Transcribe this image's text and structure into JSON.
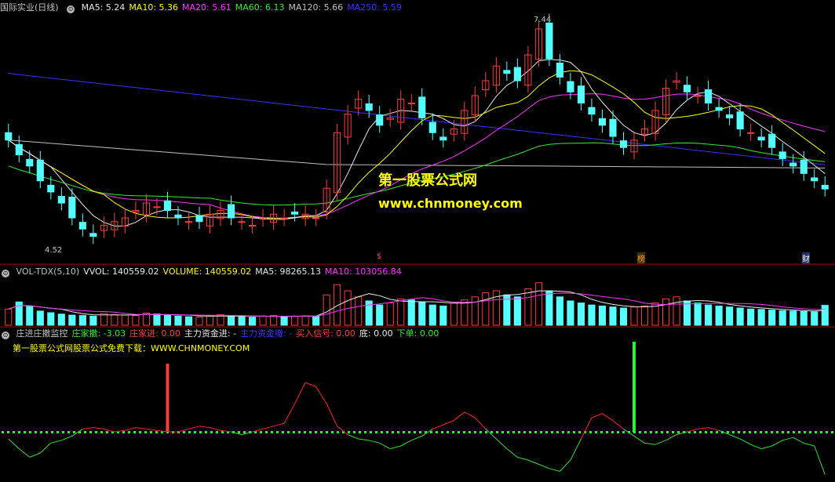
{
  "colors": {
    "bg": "#000000",
    "divider": "#9b0000",
    "up": "#ff3b3b",
    "down": "#54ffff",
    "ma5": "#e8e8e8",
    "ma10": "#ffff00",
    "ma20": "#ff33ff",
    "ma60": "#33ee33",
    "ma120": "#c0c0c0",
    "ma250": "#3333ff",
    "vol_ma10": "#ff33ff",
    "main_line": "#ff2020",
    "main_line_neg": "#33dd33",
    "dots": "#33ee33"
  },
  "main_panel": {
    "title": "国际实业(日线)",
    "ma_labels": [
      {
        "text": "MA5: 5.24",
        "color": "#e8e8e8"
      },
      {
        "text": "MA10: 5.36",
        "color": "#ffff00"
      },
      {
        "text": "MA20: 5.61",
        "color": "#ff33ff"
      },
      {
        "text": "MA60: 6.13",
        "color": "#33ee33"
      },
      {
        "text": "MA120: 5.66",
        "color": "#c0c0c0"
      },
      {
        "text": "MA250: 5.59",
        "color": "#3333ff"
      }
    ],
    "high_label": "7.44",
    "low_label": "4.52",
    "watermark_cn": "第一股票公式网",
    "watermark_url": "www.chnmoney.com",
    "markers": [
      "$",
      "榜",
      "财"
    ]
  },
  "volume_panel": {
    "labels": [
      {
        "text": "VOL-TDX(5,10)",
        "color": "#c0c0c0"
      },
      {
        "text": "VVOL: 140559.02",
        "color": "#e8e8e8"
      },
      {
        "text": "VOLUME: 140559.02",
        "color": "#ffff00"
      },
      {
        "text": "MA5: 98265.13",
        "color": "#e8e8e8"
      },
      {
        "text": "MA10: 103056.84",
        "color": "#ff33ff"
      }
    ]
  },
  "indicator_panel": {
    "labels": [
      {
        "text": "庄进庄撤监控",
        "color": "#c0c0c0"
      },
      {
        "text": "庄家撤: -3.03",
        "color": "#33ee33"
      },
      {
        "text": "庄家进: 0.00",
        "color": "#ff3b3b"
      },
      {
        "text": "主力资金进: -",
        "color": "#e8e8e8"
      },
      {
        "text": "主力资金撤: -",
        "color": "#3333ff"
      },
      {
        "text": "买入信号: 0.00",
        "color": "#ff3b3b"
      },
      {
        "text": "底: 0.00",
        "color": "#e8e8e8"
      },
      {
        "text": "下单: 0.00",
        "color": "#33ee33"
      }
    ],
    "subtitle": "第一股票公式网股票公式免费下载：WWW.CHNMONEY.COM"
  },
  "chart_data": {
    "type": "candlestick",
    "title": "国际实业(日线)",
    "period": "daily",
    "price_range": [
      4.3,
      7.6
    ],
    "high": 7.44,
    "low": 4.52,
    "n_candles": 78,
    "close": [
      5.9,
      5.7,
      5.55,
      5.35,
      5.2,
      5.05,
      4.85,
      4.7,
      4.6,
      4.75,
      4.8,
      4.85,
      4.95,
      5.05,
      5.0,
      4.95,
      4.85,
      4.8,
      4.8,
      4.9,
      4.95,
      4.85,
      4.8,
      4.75,
      4.85,
      4.9,
      4.85,
      4.9,
      4.9,
      4.85,
      5.25,
      6.0,
      6.25,
      6.45,
      6.3,
      6.1,
      6.2,
      6.45,
      6.4,
      6.2,
      6.0,
      5.9,
      6.05,
      6.3,
      6.5,
      6.7,
      6.9,
      6.8,
      6.7,
      7.05,
      7.4,
      7.0,
      6.75,
      6.55,
      6.4,
      6.25,
      6.1,
      5.95,
      5.8,
      5.9,
      6.05,
      6.3,
      6.6,
      6.7,
      6.55,
      6.5,
      6.4,
      6.3,
      6.2,
      6.05,
      6.0,
      5.9,
      5.8,
      5.65,
      5.55,
      5.45,
      5.35,
      5.24
    ],
    "volume": [
      80000,
      115000,
      95000,
      70000,
      62000,
      55000,
      50000,
      48000,
      45000,
      58000,
      52000,
      50000,
      48000,
      60000,
      55000,
      50000,
      45000,
      42000,
      40000,
      48000,
      52000,
      45000,
      42000,
      40000,
      45000,
      48000,
      42000,
      45000,
      46000,
      44000,
      150000,
      200000,
      170000,
      140000,
      120000,
      100000,
      110000,
      130000,
      125000,
      115000,
      100000,
      95000,
      110000,
      125000,
      140000,
      160000,
      170000,
      150000,
      140000,
      180000,
      210000,
      170000,
      140000,
      120000,
      110000,
      100000,
      95000,
      90000,
      85000,
      90000,
      95000,
      110000,
      130000,
      140000,
      120000,
      110000,
      100000,
      95000,
      90000,
      85000,
      80000,
      78000,
      75000,
      72000,
      70000,
      68000,
      66000,
      98265
    ],
    "indicator": [
      -0.5,
      -1.2,
      -1.8,
      -1.5,
      -0.8,
      -0.6,
      -0.3,
      0.2,
      0.3,
      0.2,
      0.0,
      0.1,
      0.3,
      0.2,
      0.1,
      0.0,
      0.0,
      0.2,
      0.4,
      0.3,
      0.1,
      0.0,
      -0.2,
      0.0,
      0.2,
      0.4,
      0.6,
      2.0,
      3.5,
      3.2,
      2.0,
      0.4,
      -0.2,
      -0.5,
      -0.6,
      -0.8,
      -1.2,
      -1.0,
      -0.6,
      -0.3,
      0.2,
      0.5,
      0.8,
      1.4,
      1.0,
      0.2,
      -0.5,
      -1.2,
      -1.8,
      -2.0,
      -2.3,
      -2.6,
      -2.8,
      -2.0,
      -0.5,
      1.0,
      1.3,
      0.8,
      0.2,
      -0.3,
      -0.8,
      -0.9,
      -0.6,
      -0.2,
      0.0,
      0.2,
      0.3,
      0.1,
      -0.2,
      -0.5,
      -0.9,
      -1.2,
      -1.0,
      -0.6,
      -0.4,
      -0.8,
      -1.0,
      -3.03
    ],
    "signals": [
      {
        "type": "buy",
        "index": 15
      },
      {
        "type": "sell",
        "index": 59
      }
    ]
  }
}
